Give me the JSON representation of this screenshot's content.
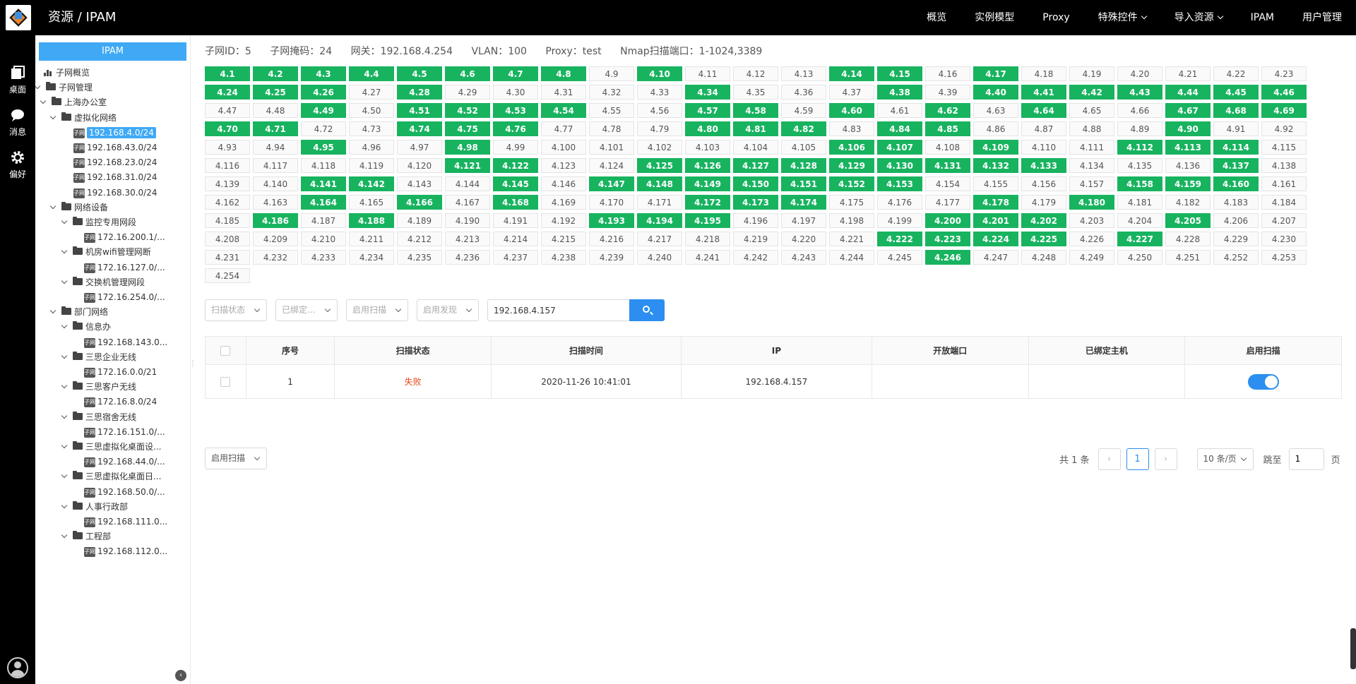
{
  "app": {
    "title": "资源 / IPAM"
  },
  "topnav": [
    {
      "label": "概览",
      "dropdown": false
    },
    {
      "label": "实例模型",
      "dropdown": false
    },
    {
      "label": "Proxy",
      "dropdown": false
    },
    {
      "label": "特殊控件",
      "dropdown": true
    },
    {
      "label": "导入资源",
      "dropdown": true
    },
    {
      "label": "IPAM",
      "dropdown": false
    },
    {
      "label": "用户管理",
      "dropdown": false
    }
  ],
  "rail": [
    {
      "label": "桌面",
      "icon": "desktop-icon"
    },
    {
      "label": "消息",
      "icon": "message-icon"
    },
    {
      "label": "偏好",
      "icon": "gear-icon"
    }
  ],
  "tree": {
    "header": "IPAM",
    "subnet_tag": "子网",
    "nodes": [
      {
        "label": "子网概览",
        "type": "chart",
        "depth": 1,
        "caret": false
      },
      {
        "label": "子网管理",
        "type": "folder",
        "depth": 0,
        "caret": true
      },
      {
        "label": "上海办公室",
        "type": "folder",
        "depth": 1,
        "caret": true
      },
      {
        "label": "虚拟化网络",
        "type": "folder",
        "depth": 2,
        "caret": true
      },
      {
        "label": "192.168.4.0/24",
        "type": "subnet",
        "depth": 3,
        "caret": false,
        "selected": true
      },
      {
        "label": "192.168.43.0/24",
        "type": "subnet",
        "depth": 3,
        "caret": false
      },
      {
        "label": "192.168.23.0/24",
        "type": "subnet",
        "depth": 3,
        "caret": false
      },
      {
        "label": "192.168.31.0/24",
        "type": "subnet",
        "depth": 3,
        "caret": false
      },
      {
        "label": "192.168.30.0/24",
        "type": "subnet",
        "depth": 3,
        "caret": false
      },
      {
        "label": "网络设备",
        "type": "folder",
        "depth": 2,
        "caret": true
      },
      {
        "label": "监控专用网段",
        "type": "folder",
        "depth": 3,
        "caret": true
      },
      {
        "label": "172.16.200.1/...",
        "type": "subnet",
        "depth": 4,
        "caret": false
      },
      {
        "label": "机房wifi管理网断",
        "type": "folder",
        "depth": 3,
        "caret": true
      },
      {
        "label": "172.16.127.0/...",
        "type": "subnet",
        "depth": 4,
        "caret": false
      },
      {
        "label": "交换机管理网段",
        "type": "folder",
        "depth": 3,
        "caret": true
      },
      {
        "label": "172.16.254.0/...",
        "type": "subnet",
        "depth": 4,
        "caret": false
      },
      {
        "label": "部门网络",
        "type": "folder",
        "depth": 2,
        "caret": true
      },
      {
        "label": "信息办",
        "type": "folder",
        "depth": 3,
        "caret": true
      },
      {
        "label": "192.168.143.0...",
        "type": "subnet",
        "depth": 4,
        "caret": false
      },
      {
        "label": "三思企业无线",
        "type": "folder",
        "depth": 3,
        "caret": true
      },
      {
        "label": "172.16.0.0/21",
        "type": "subnet",
        "depth": 4,
        "caret": false
      },
      {
        "label": "三思客户无线",
        "type": "folder",
        "depth": 3,
        "caret": true
      },
      {
        "label": "172.16.8.0/24",
        "type": "subnet",
        "depth": 4,
        "caret": false
      },
      {
        "label": "三思宿舍无线",
        "type": "folder",
        "depth": 3,
        "caret": true
      },
      {
        "label": "172.16.151.0/...",
        "type": "subnet",
        "depth": 4,
        "caret": false
      },
      {
        "label": "三思虚拟化桌面设...",
        "type": "folder",
        "depth": 3,
        "caret": true
      },
      {
        "label": "192.168.44.0/...",
        "type": "subnet",
        "depth": 4,
        "caret": false
      },
      {
        "label": "三思虚拟化桌面日...",
        "type": "folder",
        "depth": 3,
        "caret": true
      },
      {
        "label": "192.168.50.0/...",
        "type": "subnet",
        "depth": 4,
        "caret": false
      },
      {
        "label": "人事行政部",
        "type": "folder",
        "depth": 3,
        "caret": true
      },
      {
        "label": "192.168.111.0...",
        "type": "subnet",
        "depth": 4,
        "caret": false
      },
      {
        "label": "工程部",
        "type": "folder",
        "depth": 3,
        "caret": true
      },
      {
        "label": "192.168.112.0...",
        "type": "subnet",
        "depth": 4,
        "caret": false
      }
    ]
  },
  "info": {
    "subnet_id": "子网ID：5",
    "mask": "子网掩码：24",
    "gateway": "网关：192.168.4.254",
    "vlan": "VLAN：100",
    "proxy": "Proxy：test",
    "nmap": "Nmap扫描端口：1-1024,3389"
  },
  "ip_grid": {
    "prefix": "4.",
    "count": 254,
    "used": [
      1,
      2,
      3,
      4,
      5,
      6,
      7,
      8,
      10,
      14,
      15,
      17,
      24,
      25,
      26,
      28,
      34,
      38,
      40,
      41,
      42,
      43,
      44,
      45,
      46,
      49,
      51,
      52,
      53,
      54,
      57,
      58,
      60,
      62,
      64,
      67,
      68,
      69,
      70,
      71,
      74,
      75,
      76,
      80,
      81,
      82,
      84,
      85,
      90,
      95,
      98,
      106,
      107,
      109,
      112,
      113,
      114,
      121,
      122,
      125,
      126,
      127,
      128,
      129,
      130,
      131,
      132,
      133,
      137,
      141,
      142,
      145,
      147,
      148,
      149,
      150,
      151,
      152,
      153,
      158,
      159,
      160,
      164,
      166,
      168,
      172,
      173,
      174,
      178,
      180,
      186,
      188,
      193,
      194,
      195,
      200,
      201,
      202,
      205,
      222,
      223,
      224,
      225,
      227,
      246
    ],
    "used_color": "#18b35f"
  },
  "filters": {
    "scan_status": "扫描状态",
    "bound": "已绑定...",
    "enable_scan": "启用扫描",
    "enable_discovery": "启用发现",
    "search_value": "192.168.4.157"
  },
  "table": {
    "columns": [
      "序号",
      "扫描状态",
      "扫描时间",
      "IP",
      "开放端口",
      "已绑定主机",
      "启用扫描"
    ],
    "rows": [
      {
        "index": "1",
        "status": "失败",
        "time": "2020-11-26 10:41:01",
        "ip": "192.168.4.157",
        "ports": "",
        "host": "",
        "scan_enabled": true
      }
    ]
  },
  "bottom": {
    "bulk_action": "启用扫描",
    "total": "共 1 条",
    "current_page": "1",
    "page_size": "10 条/页",
    "jump_label": "跳至",
    "jump_value": "1",
    "page_suffix": "页"
  }
}
